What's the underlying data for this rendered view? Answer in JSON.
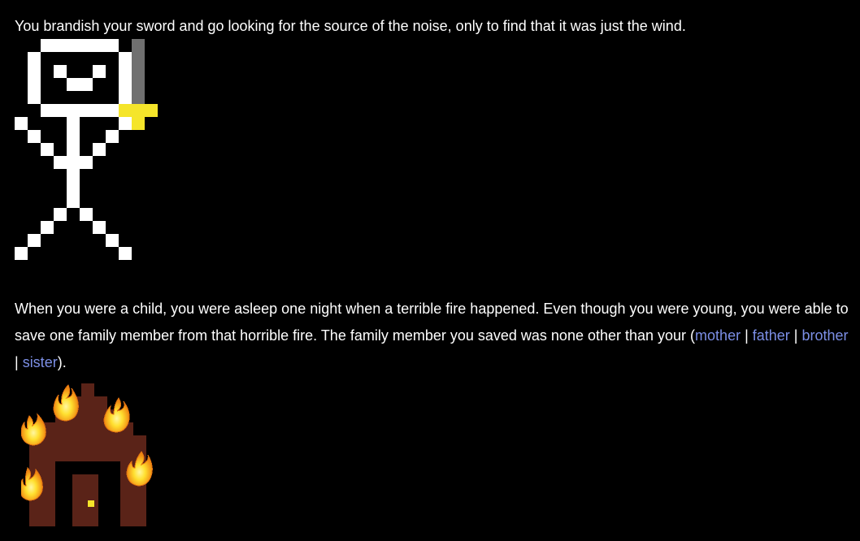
{
  "story": {
    "passage_1": "You brandish your sword and go looking for the source of the noise, only to find that it was just the wind.",
    "passage_2_text": "When you were a child, you were asleep one night when a terrible fire happened. Even though you were young, you were able to save one family member from that horrible fire. The family member you saved was none other than your (",
    "passage_2_close": ").",
    "choices": [
      {
        "label": "mother"
      },
      {
        "label": "father"
      },
      {
        "label": "brother"
      },
      {
        "label": "sister"
      }
    ],
    "separator": " | "
  },
  "colors": {
    "background": "#000000",
    "text": "#ffffff",
    "link": "#7c8fe6",
    "sword_blade": "#707070",
    "sword_hilt": "#f5e52a",
    "house": "#5a2318",
    "door_knob": "#f5e52a",
    "flame_outer": "#f08a12",
    "flame_inner": "#ffe030"
  },
  "images": {
    "stickman": "stickman-with-sword-icon",
    "house": "burning-house-icon"
  }
}
